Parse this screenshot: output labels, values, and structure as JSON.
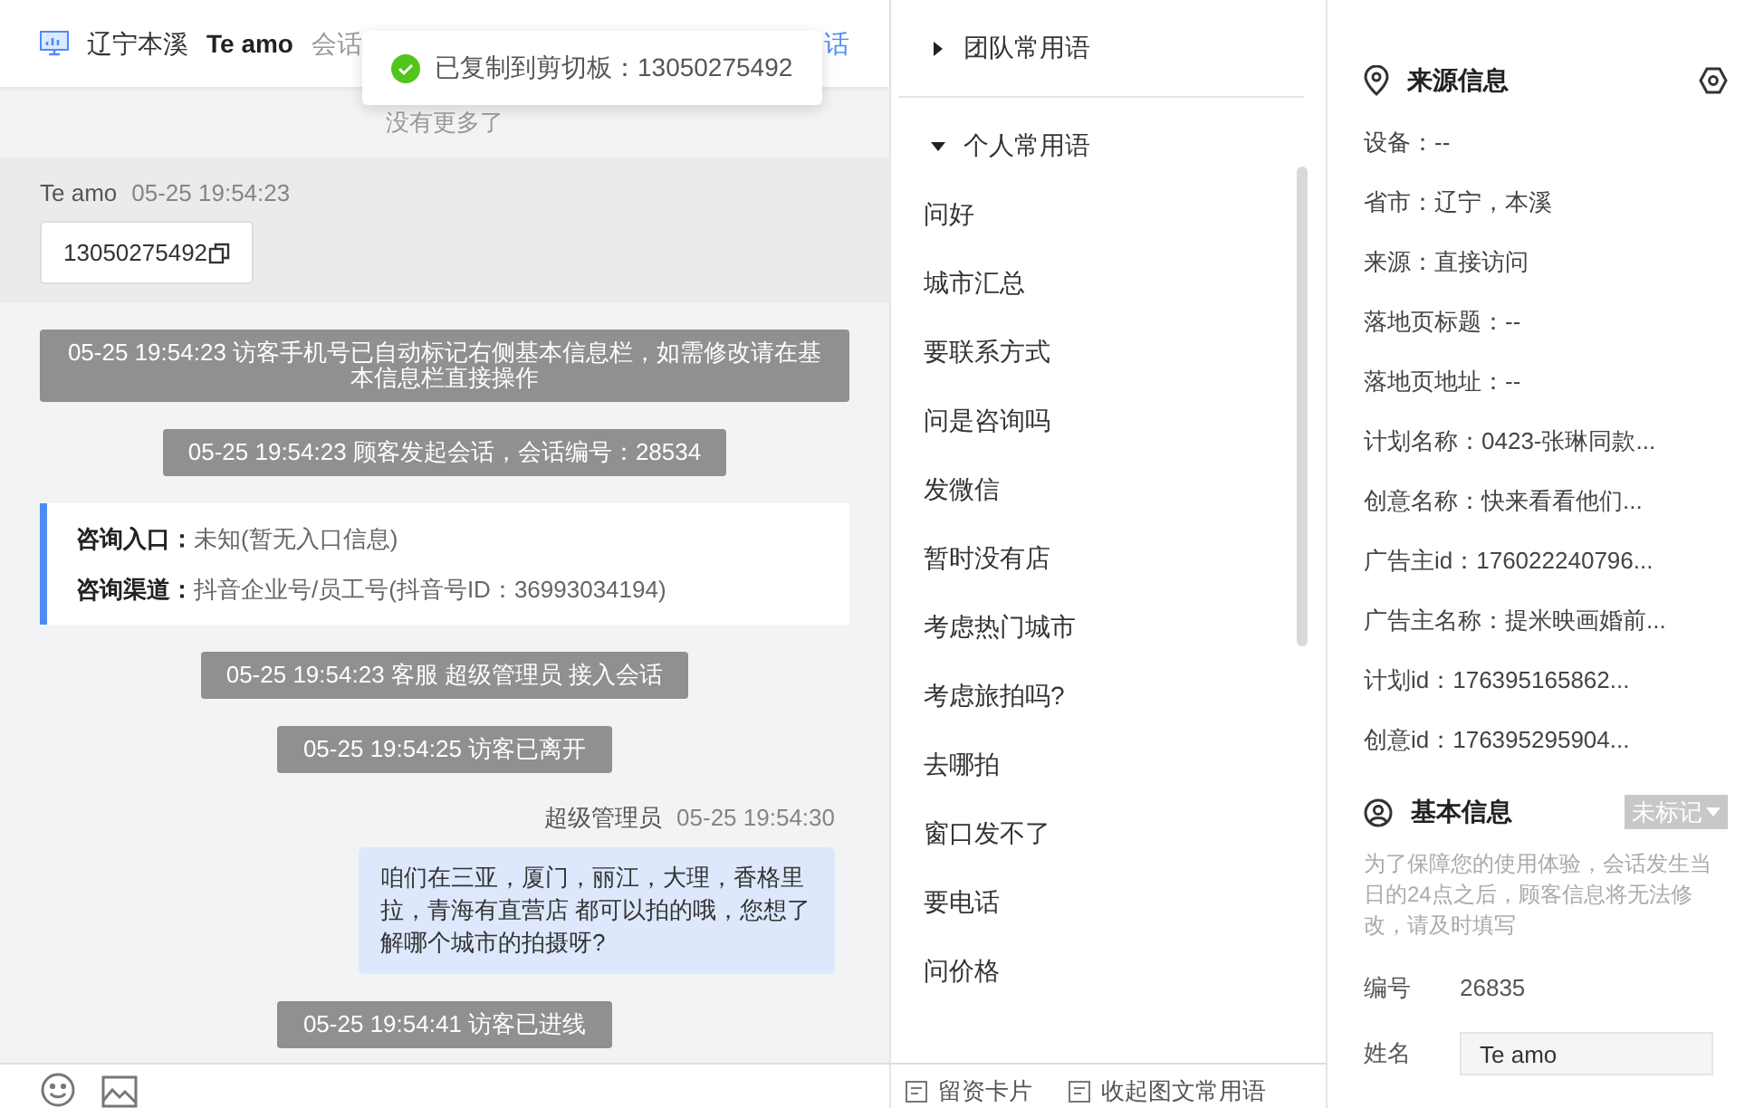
{
  "header": {
    "location": "辽宁本溪",
    "visitor": "Te amo",
    "label": "会话",
    "link": "话"
  },
  "toast": {
    "text": "已复制到剪切板：13050275492"
  },
  "chat": {
    "no_more": "没有更多了",
    "messages": [
      {
        "kind": "visitor",
        "name": "Te amo",
        "time": "05-25 19:54:23",
        "text": "13050275492"
      },
      {
        "kind": "system",
        "text": "05-25 19:54:23 访客手机号已自动标记右侧基本信息栏，如需修改请在基本信息栏直接操作"
      },
      {
        "kind": "system",
        "text": "05-25 19:54:23 顾客发起会话，会话编号：28534"
      },
      {
        "kind": "info",
        "rows": [
          {
            "label": "咨询入口：",
            "value": "未知(暂无入口信息)"
          },
          {
            "label": "咨询渠道：",
            "value": "抖音企业号/员工号(抖音号ID：36993034194)"
          }
        ]
      },
      {
        "kind": "system",
        "text": "05-25 19:54:23 客服 超级管理员 接入会话"
      },
      {
        "kind": "system",
        "text": "05-25 19:54:25 访客已离开"
      },
      {
        "kind": "agent",
        "name": "超级管理员",
        "time": "05-25 19:54:30",
        "text": "咱们在三亚，厦门，丽江，大理，香格里拉，青海有直营店 都可以拍的哦，您想了解哪个城市的拍摄呀?"
      },
      {
        "kind": "system",
        "text": "05-25 19:54:41 访客已进线"
      }
    ]
  },
  "phrases": {
    "groups": [
      {
        "title": "团队常用语",
        "expanded": false
      },
      {
        "title": "个人常用语",
        "expanded": true,
        "items": [
          "问好",
          "城市汇总",
          "要联系方式",
          "问是咨询吗",
          "发微信",
          "暂时没有店",
          "考虑热门城市",
          "考虑旅拍吗?",
          "去哪拍",
          "窗口发不了",
          "要电话",
          "问价格"
        ]
      }
    ],
    "footer": [
      "留资卡片",
      "收起图文常用语"
    ]
  },
  "source_info": {
    "title": "来源信息",
    "rows": [
      "设备：--",
      "省市：辽宁，本溪",
      "来源：直接访问",
      "落地页标题：--",
      "落地页地址：--",
      "计划名称：0423-张琳同款...",
      "创意名称：快来看看他们...",
      "广告主id：176022240796...",
      "广告主名称：提米映画婚前...",
      "计划id：176395165862...",
      "创意id：176395295904..."
    ]
  },
  "basic_info": {
    "title": "基本信息",
    "tag": "未标记",
    "notice": "为了保障您的使用体验，会话发生当日的24点之后，顾客信息将无法修改，请及时填写",
    "fields": [
      {
        "label": "编号",
        "value": "26835",
        "kind": "text"
      },
      {
        "label": "姓名",
        "value": "Te amo",
        "kind": "input"
      }
    ]
  }
}
